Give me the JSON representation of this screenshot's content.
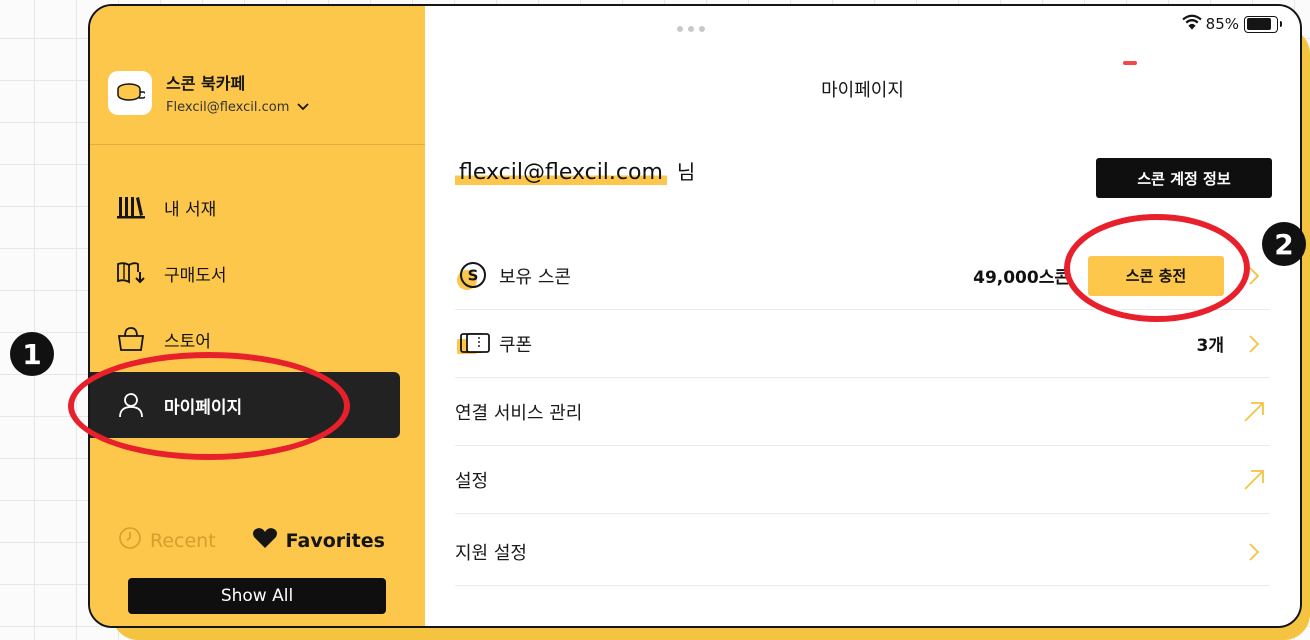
{
  "status_bar": {
    "battery": "85%"
  },
  "sidebar": {
    "app_name": "스콘 북카페",
    "account_email": "Flexcil@flexcil.com",
    "items": [
      {
        "label": "내 서재",
        "icon": "library-icon"
      },
      {
        "label": "구매도서",
        "icon": "purchased-books-icon"
      },
      {
        "label": "스토어",
        "icon": "shopping-basket-icon"
      },
      {
        "label": "마이페이지",
        "icon": "user-icon",
        "active": true
      }
    ],
    "recent_label": "Recent",
    "favorites_label": "Favorites",
    "show_all_label": "Show All"
  },
  "main": {
    "title": "마이페이지",
    "user_email": "flexcil@flexcil.com",
    "user_suffix": "님",
    "account_info_button": "스콘 계정 정보",
    "rows": [
      {
        "label": "보유 스콘",
        "value": "49,000스콘",
        "button": "스콘 충전",
        "icon": "scone-coin-icon"
      },
      {
        "label": "쿠폰",
        "value": "3개",
        "icon": "coupon-icon"
      },
      {
        "label": "연결 서비스 관리",
        "icon": "external-arrow-icon"
      },
      {
        "label": "설정",
        "icon": "external-arrow-icon"
      },
      {
        "label": "지원 설정",
        "icon": "chevron-right-icon"
      }
    ]
  },
  "annotations": {
    "badge_1": "1",
    "badge_2": "2"
  },
  "colors": {
    "accent": "#fdc74b",
    "dark": "#111111",
    "annotation_red": "#e8202b"
  }
}
